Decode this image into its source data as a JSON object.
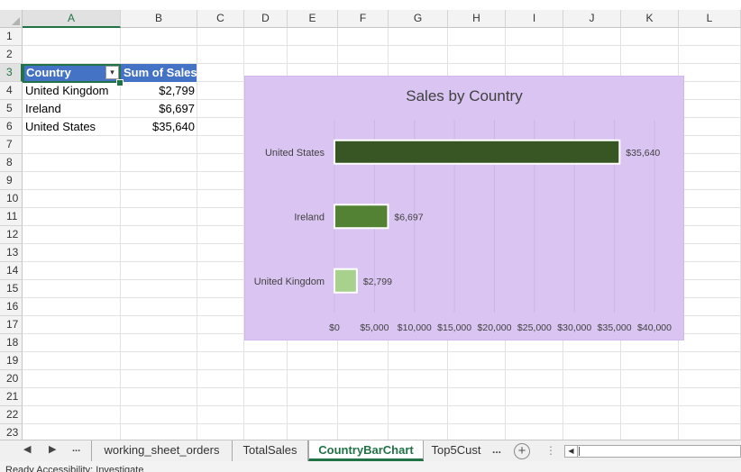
{
  "columns": [
    "A",
    "B",
    "C",
    "D",
    "E",
    "F",
    "G",
    "H",
    "I",
    "J",
    "K",
    "L"
  ],
  "rows": [
    "1",
    "2",
    "3",
    "4",
    "5",
    "6",
    "7",
    "8",
    "9",
    "10",
    "11",
    "12",
    "13",
    "14",
    "15",
    "16",
    "17",
    "18",
    "19",
    "20",
    "21",
    "22",
    "23"
  ],
  "pivot": {
    "header_country": "Country",
    "header_sales": "Sum of Sales",
    "rows": [
      {
        "country": "United Kingdom",
        "sales": "$2,799"
      },
      {
        "country": "Ireland",
        "sales": "$6,697"
      },
      {
        "country": "United States",
        "sales": "$35,640"
      }
    ]
  },
  "chart_data": {
    "type": "bar",
    "orientation": "horizontal",
    "title": "Sales by Country",
    "categories": [
      "United States",
      "Ireland",
      "United Kingdom"
    ],
    "values": [
      35640,
      6697,
      2799
    ],
    "data_labels": [
      "$35,640",
      "$6,697",
      "$2,799"
    ],
    "colors": [
      "#375623",
      "#548235",
      "#a9d18e"
    ],
    "x_ticks": [
      "$0",
      "$5,000",
      "$10,000",
      "$15,000",
      "$20,000",
      "$25,000",
      "$30,000",
      "$35,000",
      "$40,000"
    ],
    "xlim": [
      0,
      40000
    ],
    "background": "#dac5f2",
    "grid": true,
    "legend": "none"
  },
  "tabs": {
    "nav_prev": "◀",
    "nav_next": "▶",
    "nav_more": "...",
    "items": [
      "working_sheet_orders",
      "TotalSales",
      "CountryBarChart",
      "Top5Cust"
    ],
    "active": "CountryBarChart",
    "overflow": "...",
    "add": "+"
  },
  "status": {
    "text": "Ready   Accessibility: Investigate"
  },
  "accent": "#217346",
  "pivot_header_color": "#4472c4"
}
